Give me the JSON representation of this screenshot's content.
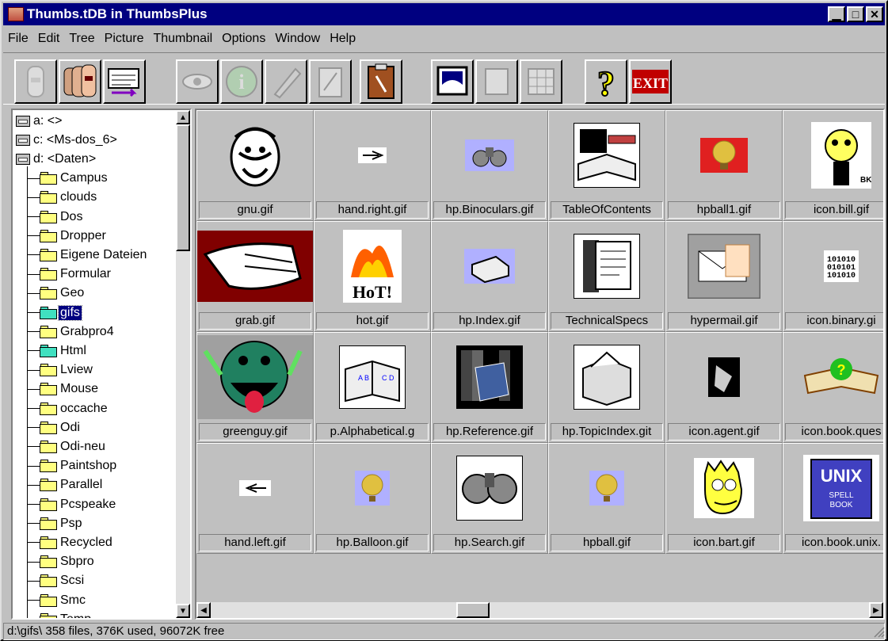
{
  "window": {
    "title": "Thumbs.tDB in ThumbsPlus"
  },
  "menu": [
    "File",
    "Edit",
    "Tree",
    "Picture",
    "Thumbnail",
    "Options",
    "Window",
    "Help"
  ],
  "toolbar": {
    "buttons": [
      {
        "name": "view-single-button",
        "icon": "person-icon",
        "disabled": true
      },
      {
        "name": "view-multiple-button",
        "icon": "people-icon",
        "disabled": false
      },
      {
        "name": "list-button",
        "icon": "list-icon",
        "disabled": false
      },
      {
        "name": "view-button",
        "icon": "eye-icon",
        "disabled": true
      },
      {
        "name": "info-button",
        "icon": "info-icon",
        "disabled": true
      },
      {
        "name": "edit-button",
        "icon": "pencil-icon",
        "disabled": true
      },
      {
        "name": "copy-button",
        "icon": "clipboard-icon",
        "disabled": true
      },
      {
        "name": "paste-button",
        "icon": "clipboard-brush-icon",
        "disabled": false
      },
      {
        "name": "wallpaper-button",
        "icon": "monitor-icon",
        "disabled": false
      },
      {
        "name": "thumb-single-button",
        "icon": "page-icon",
        "disabled": true
      },
      {
        "name": "thumb-grid-button",
        "icon": "grid-icon",
        "disabled": true
      },
      {
        "name": "help-button",
        "icon": "question-icon",
        "disabled": false
      },
      {
        "name": "exit-button",
        "icon": "exit-icon",
        "disabled": false,
        "label": "EXIT"
      }
    ]
  },
  "tree": {
    "drives": [
      "a: <>",
      "c: <Ms-dos_6>",
      "d: <Daten>"
    ],
    "folders": [
      "Campus",
      "clouds",
      "Dos",
      "Dropper",
      "Eigene Dateien",
      "Formular",
      "Geo",
      "gifs",
      "Grabpro4",
      "Html",
      "Lview",
      "Mouse",
      "occache",
      "Odi",
      "Odi-neu",
      "Paintshop",
      "Parallel",
      "Pcspeake",
      "Psp",
      "Recycled",
      "Sbpro",
      "Scsi",
      "Smc",
      "Temp"
    ],
    "selected": "gifs"
  },
  "thumbnails": [
    "gnu.gif",
    "hand.right.gif",
    "hp.Binoculars.gif",
    "TableOfContents",
    "hpball1.gif",
    "icon.bill.gif",
    "grab.gif",
    "hot.gif",
    "hp.Index.gif",
    "TechnicalSpecs",
    "hypermail.gif",
    "icon.binary.gi",
    "greenguy.gif",
    "p.Alphabetical.g",
    "hp.Reference.gif",
    "hp.TopicIndex.git",
    "icon.agent.gif",
    "icon.book.ques",
    "hand.left.gif",
    "hp.Balloon.gif",
    "hp.Search.gif",
    "hpball.gif",
    "icon.bart.gif",
    "icon.book.unix."
  ],
  "status": "d:\\gifs\\ 358 files, 376K used, 96072K free"
}
